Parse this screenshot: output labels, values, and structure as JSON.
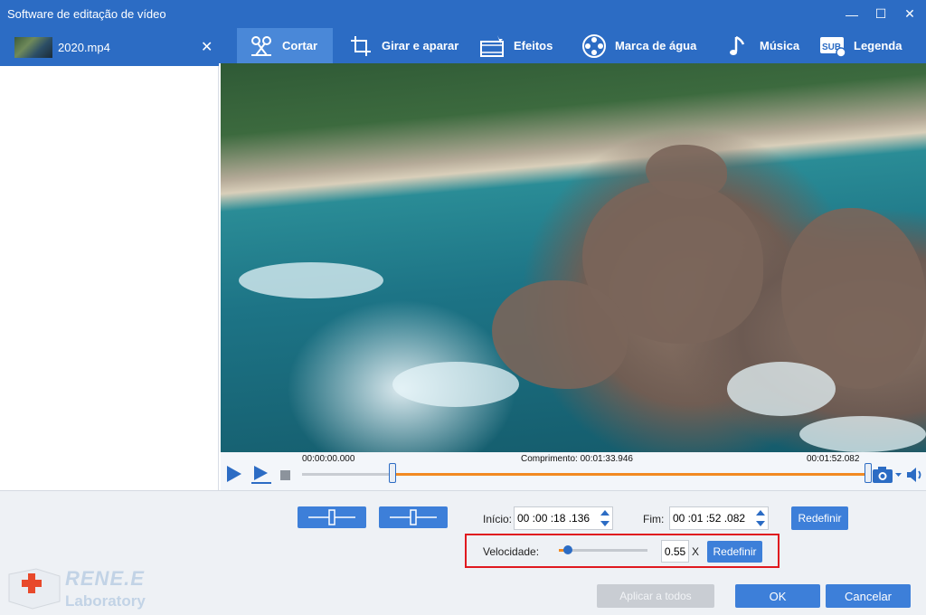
{
  "window": {
    "title": "Software de editação de vídeo",
    "controls": {
      "minimize": "—",
      "maximize": "☐",
      "close": "✕"
    }
  },
  "file_list": {
    "items": [
      {
        "name": "2020.mp4",
        "close": "✕"
      }
    ]
  },
  "tabs": [
    {
      "label": "Cortar",
      "icon": "scissors-icon",
      "active": true
    },
    {
      "label": "Girar e aparar",
      "icon": "crop-icon",
      "active": false
    },
    {
      "label": "Efeitos",
      "icon": "film-effects-icon",
      "active": false
    },
    {
      "label": "Marca de água",
      "icon": "film-reel-icon",
      "active": false
    },
    {
      "label": "Música",
      "icon": "music-note-icon",
      "active": false
    },
    {
      "label": "Legenda",
      "icon": "subtitle-icon",
      "active": false
    }
  ],
  "timeline": {
    "start_label": "00:00:00.000",
    "length_label": "Comprimento: 00:01:33.946",
    "end_label": "00:01:52.082",
    "selection_start_fraction": 0.16,
    "selection_end_fraction": 1.0
  },
  "trim": {
    "start_label": "Início:",
    "start_value": "00 :00 :18 .136",
    "end_label": "Fim:",
    "end_value": "00 :01 :52 .082",
    "reset_label": "Redefinir"
  },
  "speed": {
    "label": "Velocidade:",
    "value": "0.55",
    "unit": "X",
    "reset_label": "Redefinir",
    "slider_fraction": 0.1
  },
  "footer": {
    "apply_all": "Aplicar a todos",
    "ok": "OK",
    "cancel": "Cancelar"
  },
  "brand": {
    "line1": "RENE.E",
    "line2": "Laboratory"
  },
  "colors": {
    "accent": "#2c6cc4",
    "button": "#3d7fd9",
    "progress": "#f28a22",
    "highlight": "#e0191f"
  }
}
